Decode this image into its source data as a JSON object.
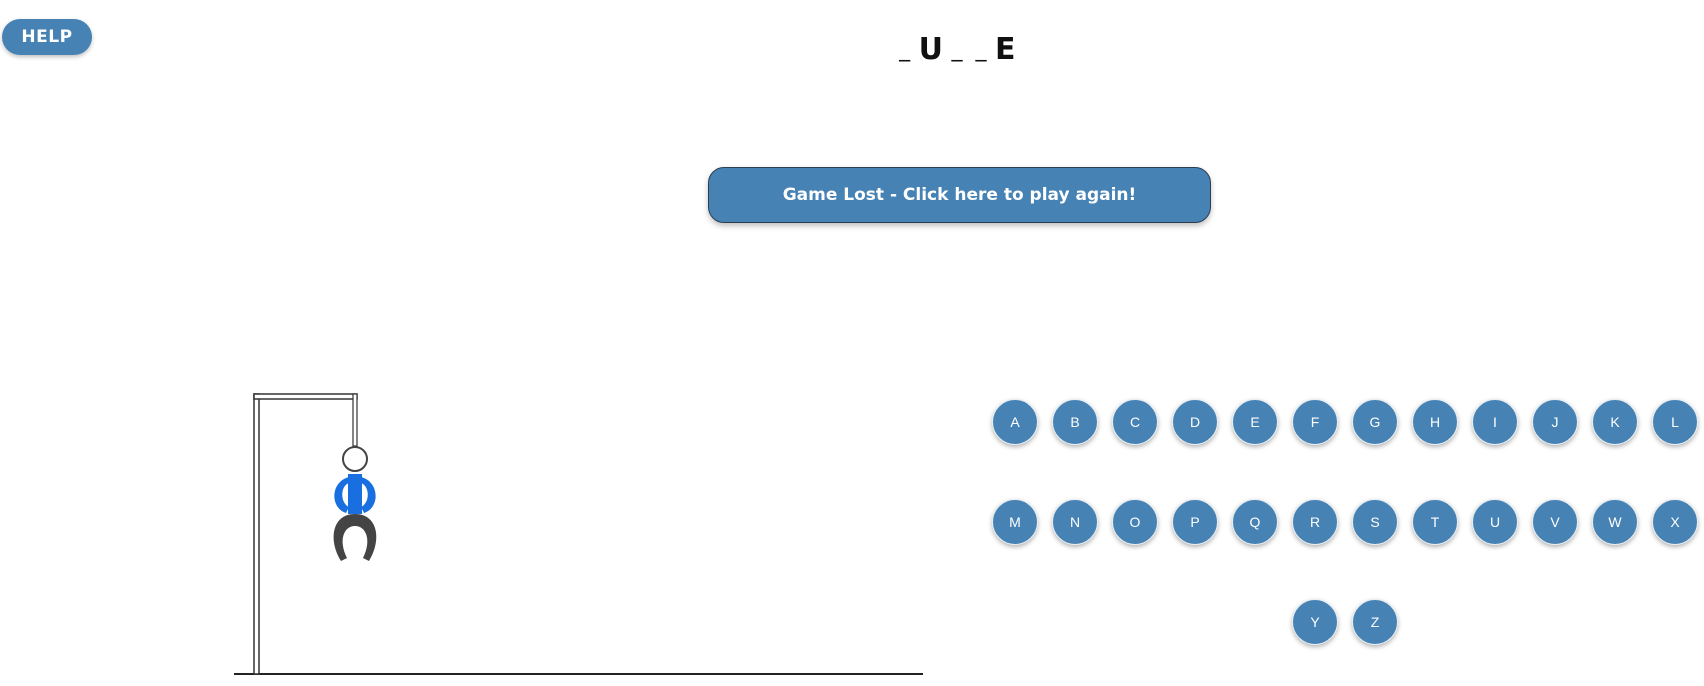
{
  "help": {
    "label": "HELP"
  },
  "word": {
    "slots": [
      "_",
      "U",
      "_",
      "_",
      "E"
    ]
  },
  "status": {
    "label": "Game Lost - Click here to play again!"
  },
  "keyboard": {
    "rows": [
      [
        "A",
        "B",
        "C",
        "D",
        "E",
        "F",
        "G",
        "H",
        "I",
        "J",
        "K",
        "L"
      ],
      [
        "M",
        "N",
        "O",
        "P",
        "Q",
        "R",
        "S",
        "T",
        "U",
        "V",
        "W",
        "X"
      ],
      [
        "Y",
        "Z"
      ]
    ]
  },
  "colors": {
    "accent": "#4682b4",
    "body": "#1a6fe0",
    "legs": "#444444"
  }
}
